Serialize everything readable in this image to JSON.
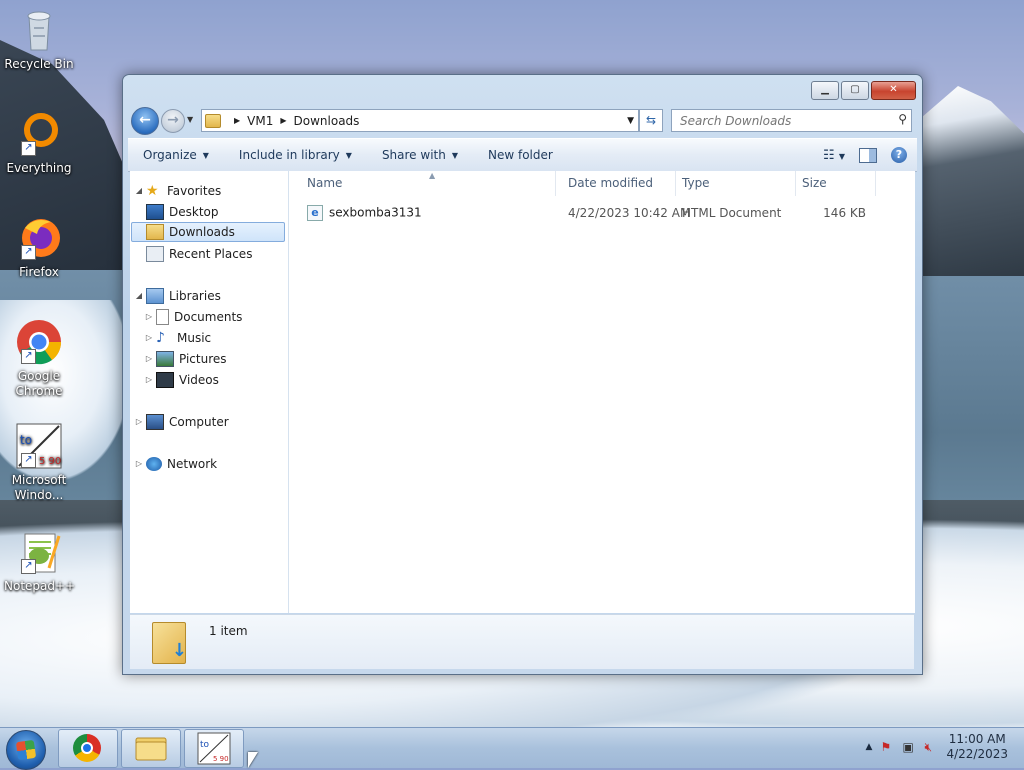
{
  "desktop": {
    "icons": [
      {
        "label": "Recycle Bin",
        "icon": "recycle-bin-icon"
      },
      {
        "label": "Everything",
        "icon": "everything-icon"
      },
      {
        "label": "Firefox",
        "icon": "firefox-icon"
      },
      {
        "label": "Google Chrome",
        "icon": "chrome-icon"
      },
      {
        "label": "Microsoft Windo...",
        "icon": "translator-icon"
      },
      {
        "label": "Notepad++",
        "icon": "notepadpp-icon"
      }
    ]
  },
  "explorer": {
    "breadcrumb": [
      "VM1",
      "Downloads"
    ],
    "search_placeholder": "Search Downloads",
    "toolbar": {
      "organize": "Organize",
      "include_in_library": "Include in library",
      "share_with": "Share with",
      "new_folder": "New folder"
    },
    "nav": {
      "favorites": "Favorites",
      "desktop": "Desktop",
      "downloads": "Downloads",
      "recent_places": "Recent Places",
      "libraries": "Libraries",
      "documents": "Documents",
      "music": "Music",
      "pictures": "Pictures",
      "videos": "Videos",
      "computer": "Computer",
      "network": "Network"
    },
    "columns": {
      "name": "Name",
      "date_modified": "Date modified",
      "type": "Type",
      "size": "Size"
    },
    "files": [
      {
        "name": "sexbomba3131",
        "date_modified": "4/22/2023 10:42 AM",
        "type": "HTML Document",
        "size": "146 KB"
      }
    ],
    "status": "1 item"
  },
  "taskbar": {
    "time": "11:00 AM",
    "date": "4/22/2023"
  }
}
